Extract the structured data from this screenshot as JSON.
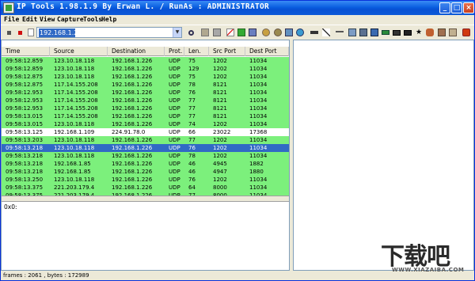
{
  "title": "IP Tools 1.98.1.9 By Erwan L. / RunAs : ADMINISTRATOR",
  "menu": [
    "File",
    "Edit",
    "View",
    "Capture",
    "Tools",
    "Help"
  ],
  "address": {
    "value": "192.168.1.226"
  },
  "table": {
    "columns": [
      "Time",
      "Source",
      "Destination",
      "Prot.",
      "Len.",
      "Src Port",
      "Dest Port"
    ],
    "rows": [
      [
        "09:58:12.859",
        "123.10.18.118",
        "192.168.1.226",
        "UDP",
        "75",
        "1202",
        "11034"
      ],
      [
        "09:58:12.859",
        "123.10.18.118",
        "192.168.1.226",
        "UDP",
        "129",
        "1202",
        "11034"
      ],
      [
        "09:58:12.875",
        "123.10.18.118",
        "192.168.1.226",
        "UDP",
        "75",
        "1202",
        "11034"
      ],
      [
        "09:58:12.875",
        "117.14.155.208",
        "192.168.1.226",
        "UDP",
        "78",
        "8121",
        "11034"
      ],
      [
        "09:58:12.953",
        "117.14.155.208",
        "192.168.1.226",
        "UDP",
        "76",
        "8121",
        "11034"
      ],
      [
        "09:58:12.953",
        "117.14.155.208",
        "192.168.1.226",
        "UDP",
        "77",
        "8121",
        "11034"
      ],
      [
        "09:58:12.953",
        "117.14.155.208",
        "192.168.1.226",
        "UDP",
        "77",
        "8121",
        "11034"
      ],
      [
        "09:58:13.015",
        "117.14.155.208",
        "192.168.1.226",
        "UDP",
        "77",
        "8121",
        "11034"
      ],
      [
        "09:58:13.015",
        "123.10.18.118",
        "192.168.1.226",
        "UDP",
        "74",
        "1202",
        "11034"
      ],
      [
        "09:58:13.125",
        "192.168.1.109",
        "224.91.78.0",
        "UDP",
        "66",
        "23022",
        "17368"
      ],
      [
        "09:58:13.203",
        "123.10.18.118",
        "192.168.1.226",
        "UDP",
        "77",
        "1202",
        "11034"
      ],
      [
        "09:58:13.218",
        "123.10.18.118",
        "192.168.1.226",
        "UDP",
        "76",
        "1202",
        "11034"
      ],
      [
        "09:58:13.218",
        "123.10.18.118",
        "192.168.1.226",
        "UDP",
        "78",
        "1202",
        "11034"
      ],
      [
        "09:58:13.218",
        "192.168.1.85",
        "192.168.1.226",
        "UDP",
        "46",
        "4945",
        "1882"
      ],
      [
        "09:58:13.218",
        "192.168.1.85",
        "192.168.1.226",
        "UDP",
        "46",
        "4947",
        "1880"
      ],
      [
        "09:58:13.250",
        "123.10.18.118",
        "192.168.1.226",
        "UDP",
        "76",
        "1202",
        "11034"
      ],
      [
        "09:58:13.375",
        "221.203.179.4",
        "192.168.1.226",
        "UDP",
        "64",
        "8000",
        "11034"
      ],
      [
        "09:58:13.375",
        "221.203.179.4",
        "192.168.1.226",
        "UDP",
        "77",
        "8000",
        "11034"
      ]
    ],
    "row_styles": [
      "green",
      "green",
      "green",
      "green",
      "green",
      "green",
      "green",
      "green",
      "green",
      "white",
      "green",
      "selected",
      "green",
      "green",
      "green",
      "green",
      "green",
      "green"
    ]
  },
  "hex_text": "0x0:",
  "status": "frames : 2061 , bytes : 172989",
  "watermark": {
    "logo": "下载吧",
    "url": "WWW.XIAZAIBA.COM"
  },
  "colors": {
    "row_green": "#7cf07c",
    "row_selected": "#316ac5",
    "titlebar": "#0a5fe0"
  },
  "toolbar_icons": [
    "stop-icon",
    "record-icon",
    "page-icon",
    "search-icon",
    "tools-icon",
    "chart-icon",
    "network-icon",
    "gear-icon",
    "monitor-icon",
    "globe-icon",
    "plug-icon",
    "cable-icon",
    "wave-icon",
    "card-icon",
    "star-icon",
    "users-icon",
    "power-icon"
  ]
}
